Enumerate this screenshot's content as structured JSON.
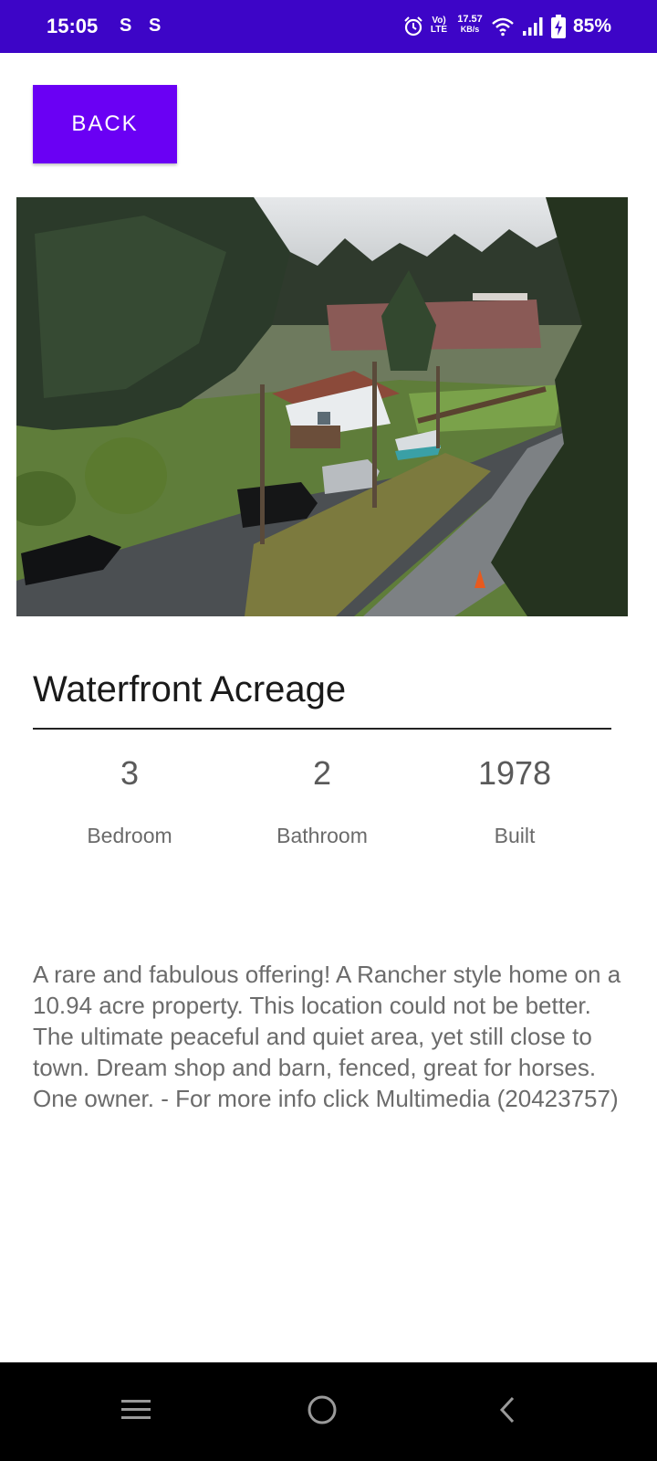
{
  "status_bar": {
    "time": "15:05",
    "notif_icons": [
      "S",
      "S"
    ],
    "volte_line1": "Vo)",
    "volte_line2": "LTE",
    "net_speed_value": "17.57",
    "net_speed_unit": "KB/s",
    "battery_percent": "85%",
    "icons": [
      "alarm-icon",
      "volte-icon",
      "wifi-icon",
      "signal-icon",
      "battery-charging-icon"
    ]
  },
  "header": {
    "back_label": "BACK"
  },
  "listing": {
    "title": "Waterfront Acreage",
    "stats": [
      {
        "value": "3",
        "label": "Bedroom"
      },
      {
        "value": "2",
        "label": "Bathroom"
      },
      {
        "value": "1978",
        "label": "Built"
      }
    ],
    "description": "A rare and fabulous offering! A Rancher style home on a 10.94 acre property. This location could not be better. The ultimate peaceful and quiet area, yet still close to town. Dream shop and barn, fenced, great for horses. One owner. - For more info click Multimedia (20423757)"
  },
  "nav_bar": {
    "icons": [
      "menu-icon",
      "home-icon",
      "back-icon"
    ]
  },
  "colors": {
    "status_bar_bg": "#3d05c7",
    "button_bg": "#6a00f4",
    "nav_bg": "#000000"
  }
}
